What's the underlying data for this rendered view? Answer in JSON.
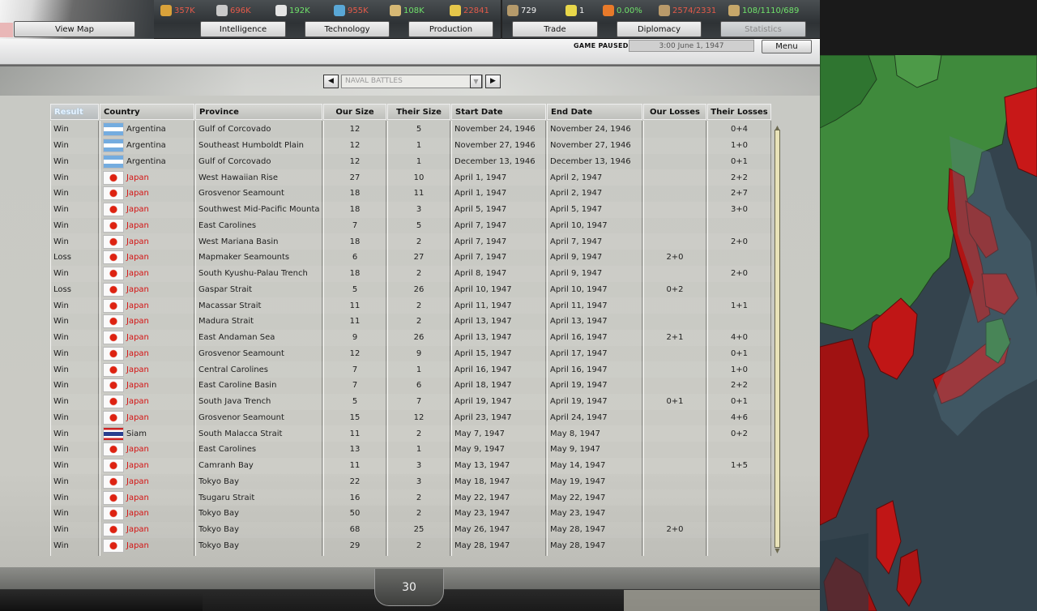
{
  "resources": [
    {
      "icon": "energy-icon",
      "value": "357K",
      "tone": "red",
      "color": "#d9a23a"
    },
    {
      "icon": "metal-icon",
      "value": "696K",
      "tone": "red",
      "color": "#c9c9c9"
    },
    {
      "icon": "rare-materials-icon",
      "value": "192K",
      "tone": "green",
      "color": "#e4e4e4"
    },
    {
      "icon": "oil-icon",
      "value": "955K",
      "tone": "red",
      "color": "#59a7d6"
    },
    {
      "icon": "supplies-icon",
      "value": "108K",
      "tone": "green",
      "color": "#d6b874"
    },
    {
      "icon": "money-icon",
      "value": "22841",
      "tone": "red",
      "color": "#e6c74a"
    },
    {
      "icon": "manpower-icon",
      "value": "729",
      "tone": "white",
      "color": "#b59a6b"
    },
    {
      "icon": "nuke-icon",
      "value": "1",
      "tone": "white",
      "color": "#e8d74a"
    },
    {
      "icon": "dissent-icon",
      "value": "0.00%",
      "tone": "green",
      "color": "#e87a2a"
    },
    {
      "icon": "transport-icon",
      "value": "2574/2331",
      "tone": "red",
      "color": "#b99a6a"
    },
    {
      "icon": "convoy-icon",
      "value": "108/1110/689",
      "tone": "green",
      "color": "#c6a76a"
    }
  ],
  "tabs": {
    "view_map": "View Map",
    "intelligence": "Intelligence",
    "technology": "Technology",
    "production": "Production",
    "trade": "Trade",
    "diplomacy": "Diplomacy",
    "statistics": "Statistics"
  },
  "status": {
    "paused": "GAME PAUSED",
    "date": "3:00 June 1, 1947",
    "menu": "Menu"
  },
  "selector": {
    "value": "NAVAL BATTLES"
  },
  "table": {
    "headers": [
      "Result",
      "Country",
      "Province",
      "Our Size",
      "Their Size",
      "Start Date",
      "End Date",
      "Our Losses",
      "Their Losses"
    ],
    "rows": [
      [
        "Win",
        "ar",
        "Argentina",
        "Gulf of Corcovado",
        "12",
        "5",
        "November 24, 1946",
        "November 24, 1946",
        "",
        "0+4"
      ],
      [
        "Win",
        "ar",
        "Argentina",
        "Southeast Humboldt Plain",
        "12",
        "1",
        "November 27, 1946",
        "November 27, 1946",
        "",
        "1+0"
      ],
      [
        "Win",
        "ar",
        "Argentina",
        "Gulf of Corcovado",
        "12",
        "1",
        "December 13, 1946",
        "December 13, 1946",
        "",
        "0+1"
      ],
      [
        "Win",
        "jp",
        "Japan",
        "West Hawaiian Rise",
        "27",
        "10",
        "April 1, 1947",
        "April 2, 1947",
        "",
        "2+2"
      ],
      [
        "Win",
        "jp",
        "Japan",
        "Grosvenor Seamount",
        "18",
        "11",
        "April 1, 1947",
        "April 2, 1947",
        "",
        "2+7"
      ],
      [
        "Win",
        "jp",
        "Japan",
        "Southwest Mid-Pacific Mounta",
        "18",
        "3",
        "April 5, 1947",
        "April 5, 1947",
        "",
        "3+0"
      ],
      [
        "Win",
        "jp",
        "Japan",
        "East Carolines",
        "7",
        "5",
        "April 7, 1947",
        "April 10, 1947",
        "",
        ""
      ],
      [
        "Win",
        "jp",
        "Japan",
        "West Mariana Basin",
        "18",
        "2",
        "April 7, 1947",
        "April 7, 1947",
        "",
        "2+0"
      ],
      [
        "Loss",
        "jp",
        "Japan",
        "Mapmaker Seamounts",
        "6",
        "27",
        "April 7, 1947",
        "April 9, 1947",
        "2+0",
        ""
      ],
      [
        "Win",
        "jp",
        "Japan",
        "South Kyushu-Palau Trench",
        "18",
        "2",
        "April 8, 1947",
        "April 9, 1947",
        "",
        "2+0"
      ],
      [
        "Loss",
        "jp",
        "Japan",
        "Gaspar Strait",
        "5",
        "26",
        "April 10, 1947",
        "April 10, 1947",
        "0+2",
        ""
      ],
      [
        "Win",
        "jp",
        "Japan",
        "Macassar Strait",
        "11",
        "2",
        "April 11, 1947",
        "April 11, 1947",
        "",
        "1+1"
      ],
      [
        "Win",
        "jp",
        "Japan",
        "Madura Strait",
        "11",
        "2",
        "April 13, 1947",
        "April 13, 1947",
        "",
        ""
      ],
      [
        "Win",
        "jp",
        "Japan",
        "East Andaman Sea",
        "9",
        "26",
        "April 13, 1947",
        "April 16, 1947",
        "2+1",
        "4+0"
      ],
      [
        "Win",
        "jp",
        "Japan",
        "Grosvenor Seamount",
        "12",
        "9",
        "April 15, 1947",
        "April 17, 1947",
        "",
        "0+1"
      ],
      [
        "Win",
        "jp",
        "Japan",
        "Central Carolines",
        "7",
        "1",
        "April 16, 1947",
        "April 16, 1947",
        "",
        "1+0"
      ],
      [
        "Win",
        "jp",
        "Japan",
        "East Caroline Basin",
        "7",
        "6",
        "April 18, 1947",
        "April 19, 1947",
        "",
        "2+2"
      ],
      [
        "Win",
        "jp",
        "Japan",
        "South Java Trench",
        "5",
        "7",
        "April 19, 1947",
        "April 19, 1947",
        "0+1",
        "0+1"
      ],
      [
        "Win",
        "jp",
        "Japan",
        "Grosvenor Seamount",
        "15",
        "12",
        "April 23, 1947",
        "April 24, 1947",
        "",
        "4+6"
      ],
      [
        "Win",
        "th",
        "Siam",
        "South Malacca Strait",
        "11",
        "2",
        "May 7, 1947",
        "May 8, 1947",
        "",
        "0+2"
      ],
      [
        "Win",
        "jp",
        "Japan",
        "East Carolines",
        "13",
        "1",
        "May 9, 1947",
        "May 9, 1947",
        "",
        ""
      ],
      [
        "Win",
        "jp",
        "Japan",
        "Camranh Bay",
        "11",
        "3",
        "May 13, 1947",
        "May 14, 1947",
        "",
        "1+5"
      ],
      [
        "Win",
        "jp",
        "Japan",
        "Tokyo Bay",
        "22",
        "3",
        "May 18, 1947",
        "May 19, 1947",
        "",
        ""
      ],
      [
        "Win",
        "jp",
        "Japan",
        "Tsugaru Strait",
        "16",
        "2",
        "May 22, 1947",
        "May 22, 1947",
        "",
        ""
      ],
      [
        "Win",
        "jp",
        "Japan",
        "Tokyo Bay",
        "50",
        "2",
        "May 23, 1947",
        "May 23, 1947",
        "",
        ""
      ],
      [
        "Win",
        "jp",
        "Japan",
        "Tokyo Bay",
        "68",
        "25",
        "May 26, 1947",
        "May 28, 1947",
        "2+0",
        ""
      ],
      [
        "Win",
        "jp",
        "Japan",
        "Tokyo Bay",
        "29",
        "2",
        "May 28, 1947",
        "May 28, 1947",
        "",
        ""
      ]
    ]
  },
  "page_number": "30",
  "colors": {
    "japan_text": "#d41414",
    "resource_red": "#e55a4a",
    "resource_green": "#6fe26a",
    "map_sea": "#34434d",
    "map_land_green": "#3f8a3c",
    "map_land_red": "#b81515"
  }
}
